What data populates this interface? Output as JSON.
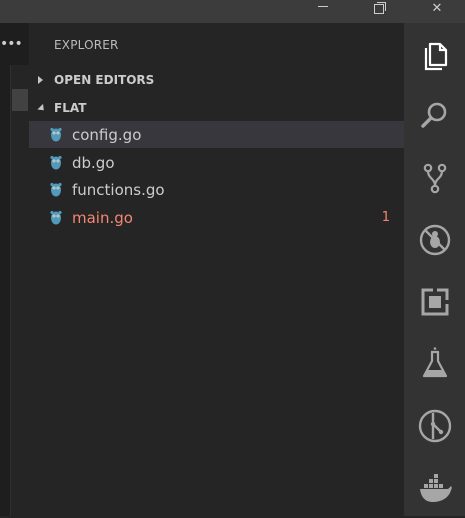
{
  "window": {
    "minimize_icon": "minimize-icon",
    "maximize_icon": "restore-icon",
    "close_icon": "close-icon",
    "close_glyph": "✕"
  },
  "sidebar": {
    "title": "EXPLORER",
    "more_glyph": "•••",
    "sections": [
      {
        "label": "OPEN EDITORS",
        "expanded": false
      },
      {
        "label": "FLAT",
        "expanded": true
      }
    ],
    "files": [
      {
        "name": "config.go",
        "selected": true,
        "error": false,
        "badge": ""
      },
      {
        "name": "db.go",
        "selected": false,
        "error": false,
        "badge": ""
      },
      {
        "name": "functions.go",
        "selected": false,
        "error": false,
        "badge": ""
      },
      {
        "name": "main.go",
        "selected": false,
        "error": true,
        "badge": "1"
      }
    ],
    "file_icon": "go-gopher-icon"
  },
  "activity_bar": {
    "items": [
      {
        "icon": "files-icon",
        "active": true
      },
      {
        "icon": "search-icon",
        "active": false
      },
      {
        "icon": "source-control-icon",
        "active": false
      },
      {
        "icon": "debug-icon",
        "active": false
      },
      {
        "icon": "extensions-icon",
        "active": false
      },
      {
        "icon": "test-flask-icon",
        "active": false
      },
      {
        "icon": "gitlens-icon",
        "active": false
      },
      {
        "icon": "docker-icon",
        "active": false
      }
    ]
  },
  "colors": {
    "error_text": "#f48771",
    "go_icon": "#519aba",
    "selected_row": "#37373d"
  }
}
